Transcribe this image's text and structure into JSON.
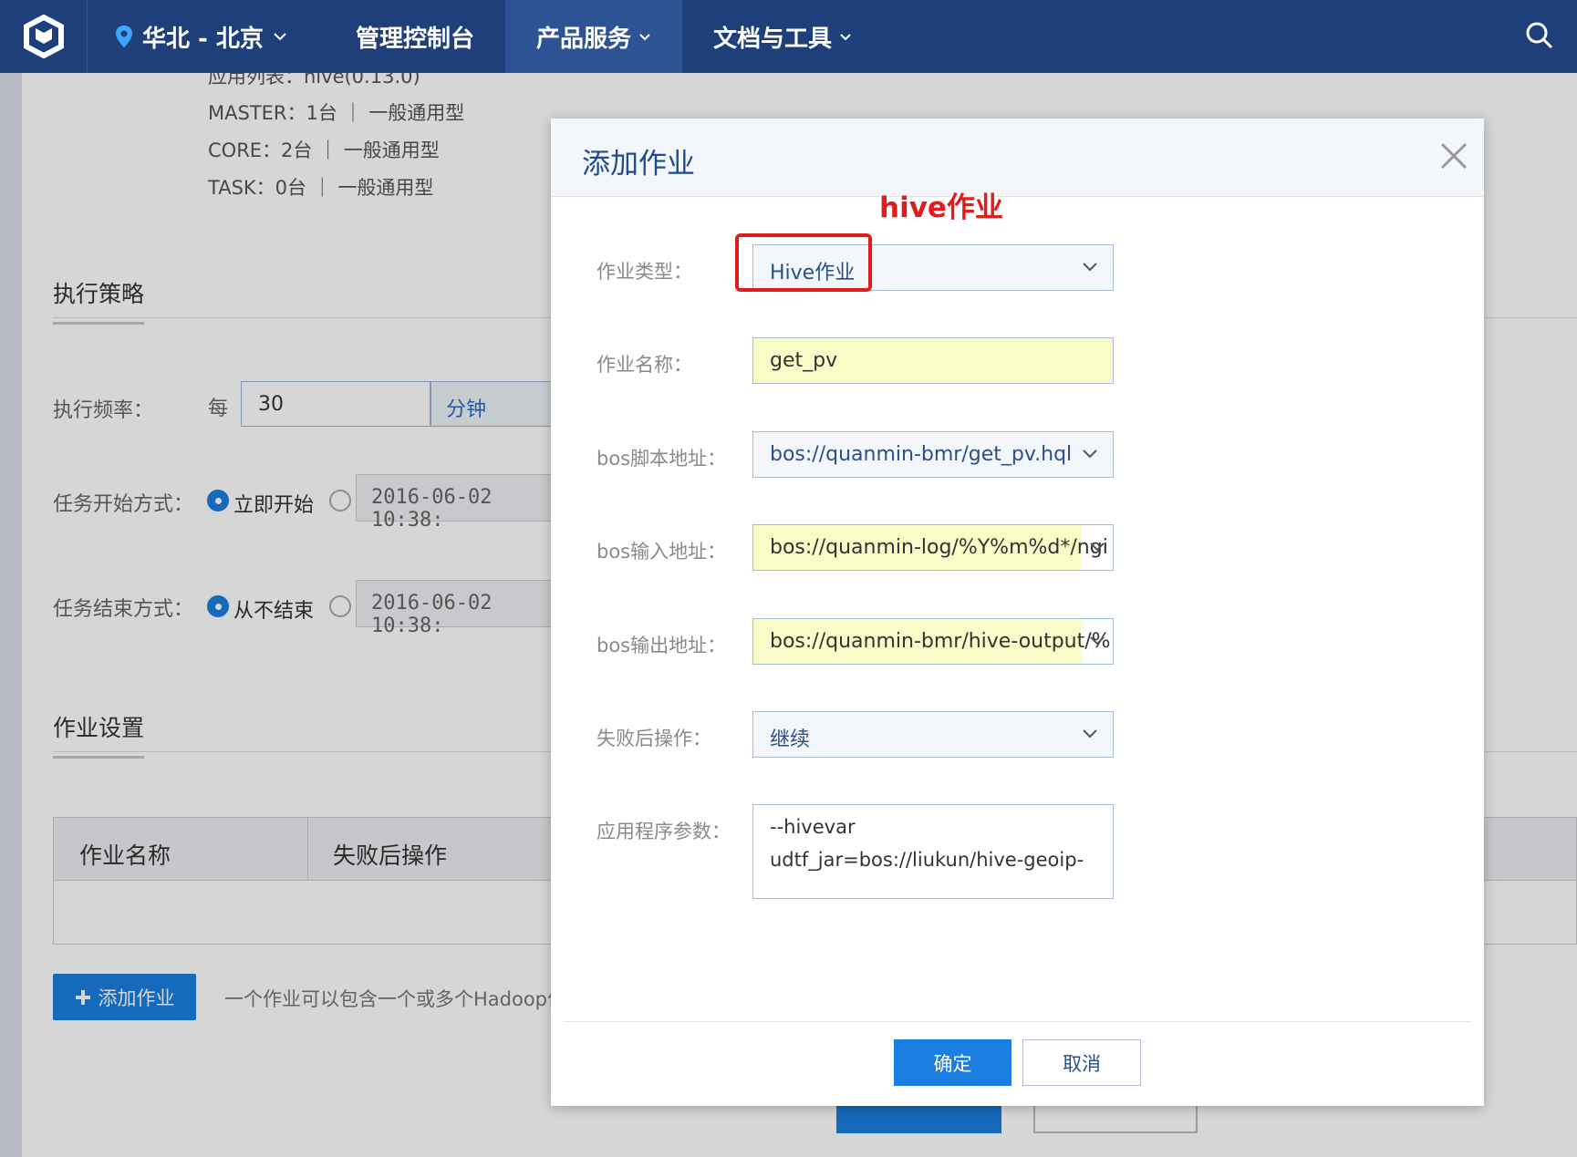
{
  "topbar": {
    "region": "华北 - 北京",
    "nav": [
      "管理控制台",
      "产品服务",
      "文档与工具"
    ]
  },
  "background": {
    "info_lines": [
      "应用列表：hive(0.13.0)",
      "MASTER：1台  ｜  一般通用型",
      "CORE：2台  ｜  一般通用型",
      "TASK：0台  ｜  一般通用型"
    ],
    "section_policy": "执行策略",
    "freq_label": "执行频率：",
    "every": "每",
    "freq_value": "30",
    "freq_unit": "分钟",
    "start_label": "任务开始方式：",
    "start_option": "立即开始",
    "start_date": "2016-06-02 10:38:",
    "end_label": "任务结束方式：",
    "end_option": "从不结束",
    "end_date": "2016-06-02 10:38:",
    "section_jobs": "作业设置",
    "table_headers": [
      "作业名称",
      "失败后操作"
    ],
    "add_job_button": "添加作业",
    "add_job_tip": "一个作业可以包含一个或多个Hadoop作"
  },
  "modal": {
    "title": "添加作业",
    "annotation": "hive作业",
    "fields": {
      "job_type": {
        "label": "作业类型：",
        "value": "Hive作业"
      },
      "job_name": {
        "label": "作业名称：",
        "value": "get_pv"
      },
      "script": {
        "label": "bos脚本地址：",
        "value": "bos://quanmin-bmr/get_pv.hql"
      },
      "input": {
        "label": "bos输入地址：",
        "value": "bos://quanmin-log/%Y%m%d*/ngi"
      },
      "output": {
        "label": "bos输出地址：",
        "value": "bos://quanmin-bmr/hive-output/%"
      },
      "on_failure": {
        "label": "失败后操作：",
        "value": "继续"
      },
      "args": {
        "label": "应用程序参数：",
        "lines": [
          "--hivevar",
          "udtf_jar=bos://liukun/hive-geoip-"
        ]
      }
    },
    "ok_button": "确定",
    "cancel_button": "取消"
  }
}
